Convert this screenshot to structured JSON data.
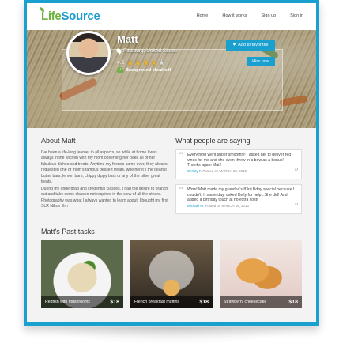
{
  "brand": {
    "part1": "Life",
    "part2": "Source"
  },
  "nav": [
    "Home",
    "How it works",
    "Sign up",
    "Sign in"
  ],
  "profile": {
    "name": "Matt",
    "location": "Pittsburg, United States",
    "rating": "4.5",
    "stars_filled": 4,
    "stars_total": 5,
    "background_label": "Background checked!",
    "favorites_button": "Add to favorites",
    "hire_button": "Hire now"
  },
  "about": {
    "title": "About Matt",
    "p1": "I've been a life-long learner in all aspects, so while at home I was always in the kitchen with my mom observing her bake all of her fabulous dishes and treats. Anytime my friends came over, they always requested one of mom's famous dessert treats, whether it's the peanut butter bars, lemon bars, chippy dippy bars or any of the other great treats.",
    "p2": "During my undergrad and credential classes, I had the desire to branch out and take some classes not required in the slew of all the others. Photography was what I always wanted to learn about. I bought my first SLR Nikon film"
  },
  "reviews": {
    "title": "What people are saying",
    "items": [
      {
        "text": "Everything went super smoothly! I asked her to deliver red vines for me and she even threw in a bow as a bonus! Thanks again Matt!",
        "author": "Christy F.",
        "date": "Posted on MARCH 20, 2013"
      },
      {
        "text": "Wow! Matt made my grandpa's 83rd Bday special because I couldn't. I, same day, asked Kelly for help...She did! And added a birthday touch at no extra cost!",
        "author": "Michael M.",
        "date": "Posted on MARCH 18, 2013"
      }
    ]
  },
  "past_tasks": {
    "title": "Matt's Past tasks",
    "items": [
      {
        "name": "Redfish with mushrooms",
        "price": "$18"
      },
      {
        "name": "French breakfast muffins",
        "price": "$18"
      },
      {
        "name": "Strawberry cheesecake",
        "price": "$18"
      }
    ]
  },
  "colors": {
    "accent": "#1aa0cf",
    "green": "#6cb33f",
    "star": "#f4b227"
  },
  "icons": [
    "pin-icon",
    "star-icon",
    "check-icon",
    "heart-icon",
    "quote-icon"
  ]
}
